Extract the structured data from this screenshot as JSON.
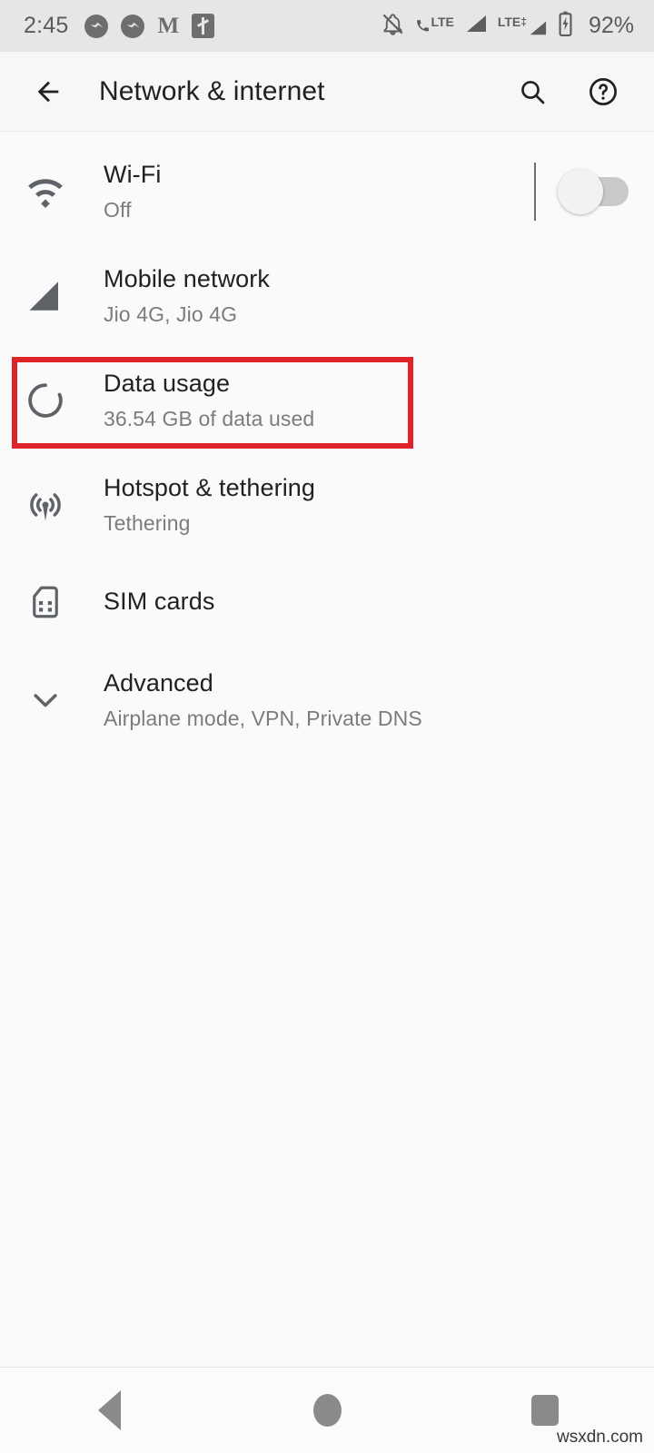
{
  "status_bar": {
    "time": "2:45",
    "left_icons": [
      "messenger-icon",
      "messenger-icon",
      "gmail-icon",
      "usb-icon"
    ],
    "gmail_glyph": "M",
    "right_icons": [
      "notifications-silenced-icon",
      "volte-call-icon",
      "signal-sim1-icon",
      "lte-plus-signal-sim2-icon",
      "battery-charging-icon"
    ],
    "signal_label_1": "LTE",
    "signal_label_2": "LTE",
    "battery_percent": "92%"
  },
  "app_bar": {
    "back_icon": "back-arrow-icon",
    "title": "Network & internet",
    "search_icon": "search-icon",
    "help_icon": "help-icon"
  },
  "settings_list": [
    {
      "icon": "wifi-icon",
      "title": "Wi-Fi",
      "subtitle": "Off",
      "has_switch": true,
      "switch_on": false
    },
    {
      "icon": "signal-bars-icon",
      "title": "Mobile network",
      "subtitle": "Jio 4G, Jio 4G",
      "has_switch": false
    },
    {
      "icon": "data-usage-ring-icon",
      "title": "Data usage",
      "subtitle": "36.54 GB of data used",
      "has_switch": false,
      "highlighted": true
    },
    {
      "icon": "hotspot-icon",
      "title": "Hotspot & tethering",
      "subtitle": "Tethering",
      "has_switch": false
    },
    {
      "icon": "sim-card-icon",
      "title": "SIM cards",
      "subtitle": "",
      "has_switch": false
    },
    {
      "icon": "chevron-down-icon",
      "title": "Advanced",
      "subtitle": "Airplane mode, VPN, Private DNS",
      "has_switch": false
    }
  ],
  "nav_bar": {
    "back": "nav-back-icon",
    "home": "nav-home-icon",
    "recents": "nav-recents-icon"
  },
  "watermark": "wsxdn.com",
  "colors": {
    "highlight_box": "#e02329",
    "background": "#fafafa",
    "status_bar_bg": "#e6e6e6",
    "primary_text": "#202124",
    "secondary_text": "#7c7c7c"
  }
}
